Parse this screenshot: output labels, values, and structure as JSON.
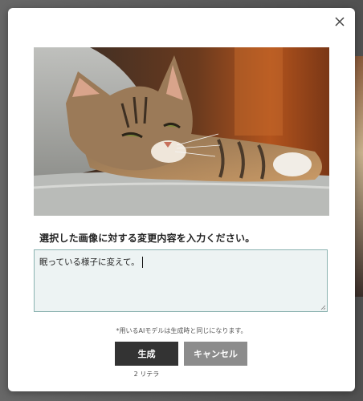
{
  "modal": {
    "close_icon": "close-icon",
    "image_alt": "cat-photo",
    "prompt_label": "選択した画像に対する変更内容を入力ください。",
    "input_value": "眠っている様子に変えて。",
    "note": "*用いるAIモデルは生成時と同じになります。",
    "generate_label": "生成",
    "cancel_label": "キャンセル",
    "retry_text": "2 リテラ"
  },
  "colors": {
    "generate_button": "#333333",
    "cancel_button": "#8c8c8c",
    "input_border": "#8ab2b0",
    "input_background": "#edf3f3"
  }
}
